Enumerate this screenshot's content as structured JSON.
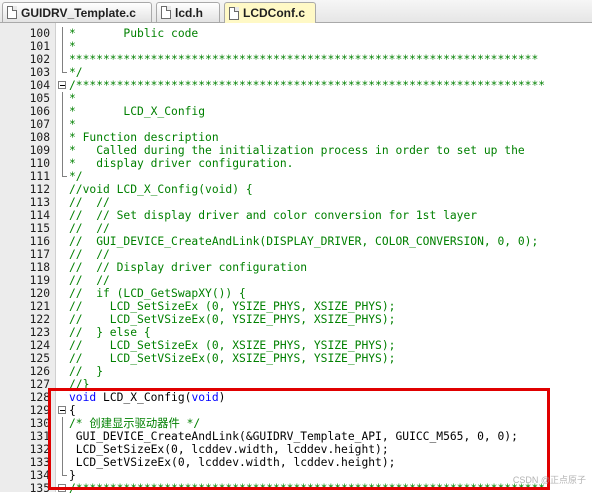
{
  "tabs": [
    {
      "label": "GUIDRV_Template.c",
      "active": false
    },
    {
      "label": "lcd.h",
      "active": false
    },
    {
      "label": "LCDConf.c",
      "active": true
    }
  ],
  "editor": {
    "lines": [
      {
        "n": "100",
        "fold": "v",
        "segs": [
          {
            "t": "*       Public code",
            "c": "comment"
          }
        ]
      },
      {
        "n": "101",
        "fold": "v",
        "segs": [
          {
            "t": "*",
            "c": "comment"
          }
        ]
      },
      {
        "n": "102",
        "fold": "v",
        "segs": [
          {
            "t": "*********************************************************************",
            "c": "comment"
          }
        ]
      },
      {
        "n": "103",
        "fold": "e",
        "segs": [
          {
            "t": "*/",
            "c": "comment"
          }
        ]
      },
      {
        "n": "104",
        "fold": "s",
        "segs": [
          {
            "t": "/*********************************************************************",
            "c": "comment"
          }
        ]
      },
      {
        "n": "105",
        "fold": "v",
        "segs": [
          {
            "t": "*",
            "c": "comment"
          }
        ]
      },
      {
        "n": "106",
        "fold": "v",
        "segs": [
          {
            "t": "*       LCD_X_Config",
            "c": "comment"
          }
        ]
      },
      {
        "n": "107",
        "fold": "v",
        "segs": [
          {
            "t": "*",
            "c": "comment"
          }
        ]
      },
      {
        "n": "108",
        "fold": "v",
        "segs": [
          {
            "t": "* Function description",
            "c": "comment"
          }
        ]
      },
      {
        "n": "109",
        "fold": "v",
        "segs": [
          {
            "t": "*   Called during the initialization process in order to set up the",
            "c": "comment"
          }
        ]
      },
      {
        "n": "110",
        "fold": "v",
        "segs": [
          {
            "t": "*   display driver configuration.",
            "c": "comment"
          }
        ]
      },
      {
        "n": "111",
        "fold": "e",
        "segs": [
          {
            "t": "*/",
            "c": "comment"
          }
        ]
      },
      {
        "n": "112",
        "fold": "",
        "segs": [
          {
            "t": "//void LCD_X_Config(void) {",
            "c": "comment"
          }
        ]
      },
      {
        "n": "113",
        "fold": "",
        "segs": [
          {
            "t": "//  //",
            "c": "comment"
          }
        ]
      },
      {
        "n": "114",
        "fold": "",
        "segs": [
          {
            "t": "//  // Set display driver and color conversion for 1st layer",
            "c": "comment"
          }
        ]
      },
      {
        "n": "115",
        "fold": "",
        "segs": [
          {
            "t": "//  //",
            "c": "comment"
          }
        ]
      },
      {
        "n": "116",
        "fold": "",
        "segs": [
          {
            "t": "//  GUI_DEVICE_CreateAndLink(DISPLAY_DRIVER, COLOR_CONVERSION, 0, 0);",
            "c": "comment"
          }
        ]
      },
      {
        "n": "117",
        "fold": "",
        "segs": [
          {
            "t": "//  //",
            "c": "comment"
          }
        ]
      },
      {
        "n": "118",
        "fold": "",
        "segs": [
          {
            "t": "//  // Display driver configuration",
            "c": "comment"
          }
        ]
      },
      {
        "n": "119",
        "fold": "",
        "segs": [
          {
            "t": "//  //",
            "c": "comment"
          }
        ]
      },
      {
        "n": "120",
        "fold": "",
        "segs": [
          {
            "t": "//  if (LCD_GetSwapXY()) {",
            "c": "comment"
          }
        ]
      },
      {
        "n": "121",
        "fold": "",
        "segs": [
          {
            "t": "//    LCD_SetSizeEx (0, YSIZE_PHYS, XSIZE_PHYS);",
            "c": "comment"
          }
        ]
      },
      {
        "n": "122",
        "fold": "",
        "segs": [
          {
            "t": "//    LCD_SetVSizeEx(0, YSIZE_PHYS, XSIZE_PHYS);",
            "c": "comment"
          }
        ]
      },
      {
        "n": "123",
        "fold": "",
        "segs": [
          {
            "t": "//  } else {",
            "c": "comment"
          }
        ]
      },
      {
        "n": "124",
        "fold": "",
        "segs": [
          {
            "t": "//    LCD_SetSizeEx (0, XSIZE_PHYS, YSIZE_PHYS);",
            "c": "comment"
          }
        ]
      },
      {
        "n": "125",
        "fold": "",
        "segs": [
          {
            "t": "//    LCD_SetVSizeEx(0, XSIZE_PHYS, YSIZE_PHYS);",
            "c": "comment"
          }
        ]
      },
      {
        "n": "126",
        "fold": "",
        "segs": [
          {
            "t": "//  }",
            "c": "comment"
          }
        ]
      },
      {
        "n": "127",
        "fold": "",
        "segs": [
          {
            "t": "//}",
            "c": "comment"
          }
        ]
      },
      {
        "n": "128",
        "fold": "",
        "segs": [
          {
            "t": "void",
            "c": "keyword"
          },
          {
            "t": " LCD_X_Config(",
            "c": "plain"
          },
          {
            "t": "void",
            "c": "keyword"
          },
          {
            "t": ")",
            "c": "plain"
          }
        ]
      },
      {
        "n": "129",
        "fold": "s",
        "segs": [
          {
            "t": "{",
            "c": "plain"
          }
        ]
      },
      {
        "n": "130",
        "fold": "v",
        "segs": [
          {
            "t": "/* 创建显示驱动器件 */",
            "c": "comment"
          }
        ]
      },
      {
        "n": "131",
        "fold": "v",
        "segs": [
          {
            "t": " GUI_DEVICE_CreateAndLink(&GUIDRV_Template_API, GUICC_M565, 0, 0);",
            "c": "plain"
          }
        ]
      },
      {
        "n": "132",
        "fold": "v",
        "segs": [
          {
            "t": " LCD_SetSizeEx(0, lcddev.width, lcddev.height);",
            "c": "plain"
          }
        ]
      },
      {
        "n": "133",
        "fold": "v",
        "segs": [
          {
            "t": " LCD_SetVSizeEx(0, lcddev.width, lcddev.height);",
            "c": "plain"
          }
        ]
      },
      {
        "n": "134",
        "fold": "e",
        "segs": [
          {
            "t": "}",
            "c": "plain"
          }
        ]
      },
      {
        "n": "135",
        "fold": "s",
        "segs": [
          {
            "t": "/*********************************************************************",
            "c": "comment"
          }
        ]
      }
    ]
  },
  "watermark": "CSDN @正点原子"
}
